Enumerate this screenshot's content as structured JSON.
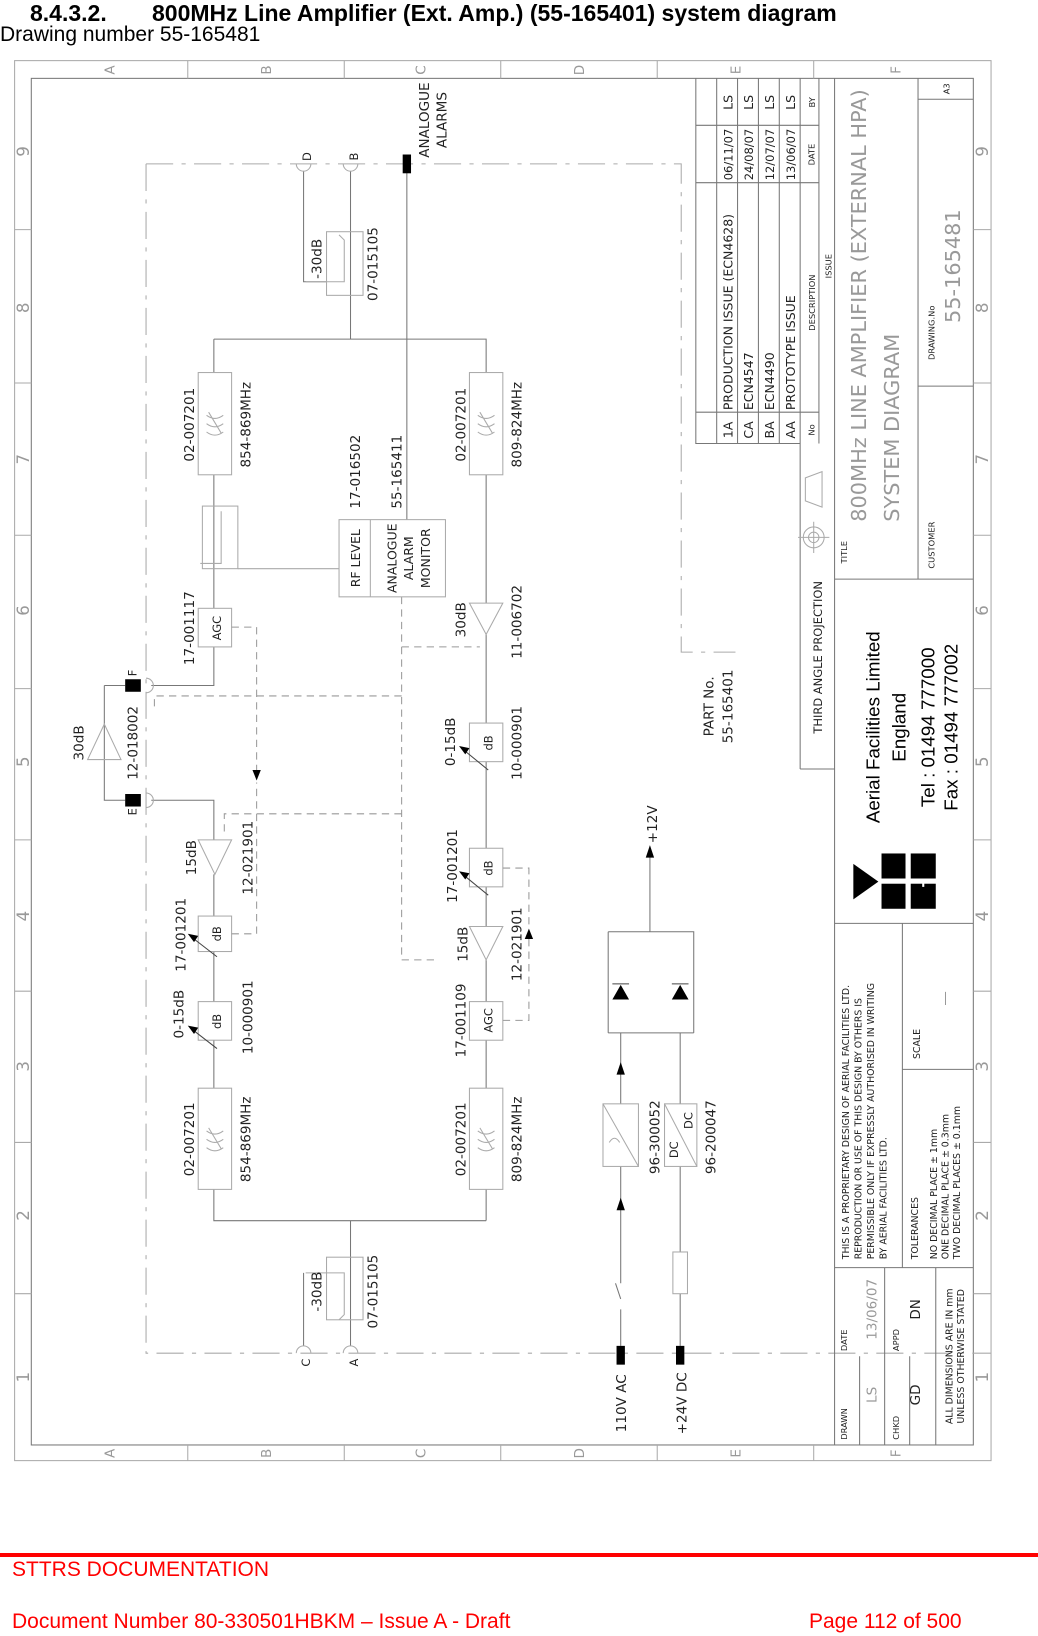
{
  "header": {
    "section_number": "8.4.3.2.",
    "section_title": "800MHz Line Amplifier (Ext. Amp.) (55-165401) system diagram",
    "subtitle": "Drawing number 55-165481"
  },
  "drawing": {
    "grid_columns": [
      "A",
      "B",
      "C",
      "D",
      "E",
      "F"
    ],
    "grid_rows": [
      "9",
      "8",
      "7",
      "6",
      "5",
      "4",
      "3",
      "2",
      "1"
    ],
    "upper_chain": {
      "filter_top": {
        "part": "02-007201",
        "band": "854-869MHz"
      },
      "agc": {
        "part": "17-001117",
        "label": "AGC"
      },
      "connector_f": "F",
      "connector_e": "E",
      "bypass_amp": {
        "gain": "30dB",
        "part": "12-018002"
      },
      "amp": {
        "gain": "15dB",
        "part": "12-021901"
      },
      "attenuator_1": {
        "part": "17-001201",
        "label": "dB"
      },
      "attenuator_2": {
        "range": "0-15dB",
        "label": "dB",
        "part": "10-000901"
      },
      "filter_bottom": {
        "part": "02-007201",
        "band": "854-869MHz"
      }
    },
    "lower_chain": {
      "filter_top": {
        "part": "02-007201",
        "band": "809-824MHz"
      },
      "amp_30": {
        "gain": "30dB",
        "part": "11-006702"
      },
      "attenuator_1": {
        "range": "0-15dB",
        "label": "dB",
        "part": "10-000901"
      },
      "attenuator_2": {
        "part": "17-001201",
        "label": "dB"
      },
      "amp_15": {
        "gain": "15dB",
        "part": "12-021901"
      },
      "agc": {
        "part": "17-001109",
        "label": "AGC"
      },
      "filter_bottom": {
        "part": "02-007201",
        "band": "809-824MHz"
      }
    },
    "top": {
      "connector_d": "D",
      "connector_b": "B",
      "coupler": {
        "value": "-30dB",
        "part": "07-015105"
      },
      "alarms_line1": "ANALOGUE",
      "alarms_line2": "ALARMS",
      "monitor_part_1": "17-016502",
      "monitor_part_2": "55-165411",
      "monitor_rf": "RF LEVEL",
      "monitor_l1": "ANALOGUE",
      "monitor_l2": "ALARM",
      "monitor_l3": "MONITOR"
    },
    "bottom": {
      "connector_c": "C",
      "connector_a": "A",
      "coupler": {
        "value": "-30dB",
        "part": "07-015105"
      }
    },
    "power": {
      "ac_input": "110V AC",
      "dc_input": "+24V DC",
      "psu_part": "96-300052",
      "dcdc_part": "96-200047",
      "dcdc_in": "DC",
      "dcdc_out": "DC",
      "output": "+12V"
    },
    "part_no_label": "PART No.",
    "part_no": "55-165401"
  },
  "title_block": {
    "revisions": [
      {
        "no": "1A",
        "description": "PRODUCTION ISSUE (ECN4628)",
        "date": "06/11/07",
        "by": "LS"
      },
      {
        "no": "CA",
        "description": "ECN4547",
        "date": "24/08/07",
        "by": "LS"
      },
      {
        "no": "BA",
        "description": "ECN4490",
        "date": "12/07/07",
        "by": "LS"
      },
      {
        "no": "AA",
        "description": "PROTOTYPE ISSUE",
        "date": "13/06/07",
        "by": "LS"
      }
    ],
    "rev_headers": {
      "no": "No",
      "description": "DESCRIPTION",
      "date": "DATE",
      "by": "BY"
    },
    "issue_label": "ISSUE",
    "title_label": "TITLE",
    "title_line1": "800MHz LINE AMPLIFIER (EXTERNAL HPA)",
    "title_line2": "SYSTEM DIAGRAM",
    "drawing_no_label": "DRAWING.No",
    "drawing_no": "55-165481",
    "sheet_size": "A3",
    "customer_label": "CUSTOMER",
    "projection": "THIRD ANGLE PROJECTION",
    "company": {
      "name": "Aerial Facilities Limited",
      "country": "England",
      "tel": "Tel : 01494 777000",
      "fax": "Fax : 01494 777002"
    },
    "copyright": [
      "THIS IS A PROPRIETARY DESIGN OF AERIAL FACILITIES LTD.",
      "REPRODUCTION OR USE OF THIS DESIGN BY OTHERS IS",
      "PERMISSIBLE ONLY IF EXPRESSLY AUTHORISED IN WRITING",
      "BY AERIAL FACILITIES LTD."
    ],
    "scale_label": "SCALE",
    "scale_value": "—",
    "tolerances_label": "TOLERANCES",
    "tolerances": [
      "NO DECIMAL PLACE ± 1mm",
      "ONE DECIMAL PLACE ± 0.3mm",
      "TWO DECIMAL PLACES ± 0.1mm"
    ],
    "drawn_label": "DRAWN",
    "drawn": "LS",
    "date_label": "DATE",
    "date": "13/06/07",
    "chkd_label": "CHKD",
    "chkd": "GD",
    "appd_label": "APPD",
    "appd": "DN",
    "dims_line1": "ALL DIMENSIONS ARE IN mm",
    "dims_line2": "UNLESS OTHERWISE STATED"
  },
  "footer": {
    "org": "STTRS DOCUMENTATION",
    "document": "Document Number 80-330501HBKM – Issue A - Draft",
    "page": "Page 112 of 500"
  },
  "colors": {
    "footer": "#ff0000",
    "drawing_line": "#777777",
    "title_gray": "#999999"
  }
}
